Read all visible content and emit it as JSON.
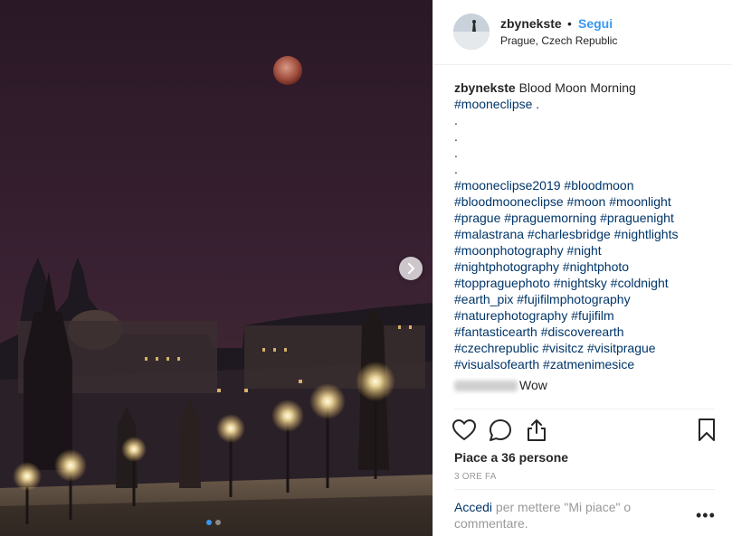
{
  "post": {
    "username": "zbynekste",
    "bullet": "•",
    "follow_label": "Segui",
    "location": "Prague, Czech Republic"
  },
  "caption": {
    "username": "zbynekste",
    "text": " Blood Moon Morning",
    "lines": [
      "#mooneclipse .",
      ".",
      ".",
      ".",
      ".",
      "#mooneclipse2019 #bloodmoon",
      "#bloodmooneclipse #moon #moonlight",
      "#prague #praguemorning #praguenight",
      "#malastrana #charlesbridge #nightlights",
      "#moonphotography #night",
      "#nightphotography #nightphoto",
      "#toppraguephoto #nightsky #coldnight",
      "#earth_pix #fujifilmphotography",
      "#naturephotography #fujifilm",
      "#fantasticearth #discoverearth",
      "#czechrepublic #visitcz #visitprague",
      "#visualsofearth #zatmenimesice"
    ]
  },
  "comment": {
    "text": "Wow"
  },
  "icons": {
    "like": "heart-icon",
    "comment": "comment-icon",
    "share": "share-icon",
    "save": "bookmark-icon",
    "next": "chevron-right-icon",
    "more": "more-icon"
  },
  "likes": "Piace a 36 persone",
  "timestamp": "3 ORE FA",
  "login_prompt": {
    "link": "Accedi",
    "text": " per mettere \"Mi piace\" o commentare."
  },
  "more_label": "•••",
  "colors": {
    "accent": "#3897f0",
    "hashtag": "#003569",
    "muted": "#999999"
  }
}
